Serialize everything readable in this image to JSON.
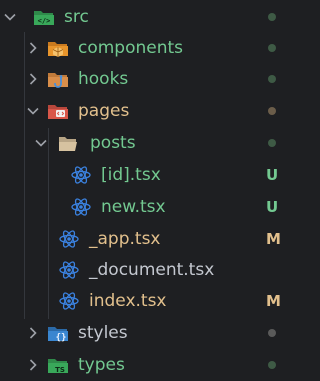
{
  "colors": {
    "background": "#1e1f22",
    "untracked": "#73c991",
    "modified": "#e2c08d",
    "ignored": "#c4c8d0",
    "dot_green": "#3e5a45",
    "dot_brown": "#6b5d4a",
    "dot_grey": "#5a5a5a",
    "chevron": "#9da1a8",
    "react": "#3b82e0"
  },
  "tree": [
    {
      "id": "src",
      "label": "src",
      "type": "folder",
      "expanded": true,
      "icon": "src-folder-icon",
      "status": "dot-green"
    },
    {
      "id": "components",
      "label": "components",
      "type": "folder",
      "expanded": false,
      "icon": "components-folder-icon",
      "status": "dot-green"
    },
    {
      "id": "hooks",
      "label": "hooks",
      "type": "folder",
      "expanded": false,
      "icon": "hooks-folder-icon",
      "status": "dot-green"
    },
    {
      "id": "pages",
      "label": "pages",
      "type": "folder",
      "expanded": true,
      "icon": "pages-folder-icon",
      "status": "dot-brown"
    },
    {
      "id": "posts",
      "label": "posts",
      "type": "folder",
      "expanded": true,
      "icon": "folder-open-icon",
      "status": "dot-green"
    },
    {
      "id": "id",
      "label": "[id].tsx",
      "type": "file",
      "icon": "react-tsx-icon",
      "status": "U"
    },
    {
      "id": "new",
      "label": "new.tsx",
      "type": "file",
      "icon": "react-tsx-icon",
      "status": "U"
    },
    {
      "id": "app",
      "label": "_app.tsx",
      "type": "file",
      "icon": "react-tsx-icon",
      "status": "M"
    },
    {
      "id": "document",
      "label": "_document.tsx",
      "type": "file",
      "icon": "react-tsx-icon",
      "status": ""
    },
    {
      "id": "index",
      "label": "index.tsx",
      "type": "file",
      "icon": "react-tsx-icon",
      "status": "M"
    },
    {
      "id": "styles",
      "label": "styles",
      "type": "folder",
      "expanded": false,
      "icon": "styles-folder-icon",
      "status": "dot-grey"
    },
    {
      "id": "types",
      "label": "types",
      "type": "folder",
      "expanded": false,
      "icon": "types-folder-icon",
      "status": "dot-green"
    }
  ]
}
